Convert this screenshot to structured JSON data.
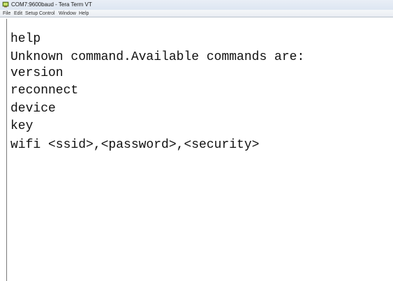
{
  "window": {
    "title": "COM7:9600baud - Tera Term VT",
    "icon": "tera-term-app-icon"
  },
  "menu": [
    "File",
    "Edit",
    "Setup",
    "Control",
    "Window",
    "Help"
  ],
  "terminal": {
    "lines": [
      "help",
      "Unknown command.Available commands are:",
      "version",
      "reconnect",
      "device",
      "key",
      "wifi <ssid>,<password>,<security>"
    ]
  }
}
